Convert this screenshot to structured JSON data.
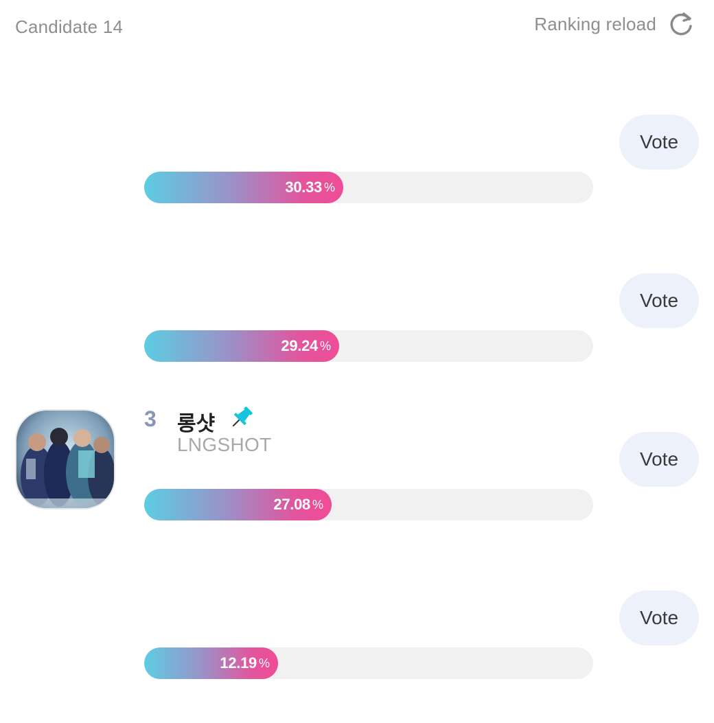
{
  "header": {
    "candidate_label": "Candidate 14",
    "reload_label": "Ranking reload"
  },
  "rows": [
    {
      "vote_label": "Vote",
      "percent": "30.33",
      "percent_sign": "%",
      "fill_fraction": 0.3033
    },
    {
      "vote_label": "Vote",
      "percent": "29.24",
      "percent_sign": "%",
      "fill_fraction": 0.2924
    },
    {
      "rank": "3",
      "name": "롱샷",
      "english_name": "LNGSHOT",
      "vote_label": "Vote",
      "percent": "27.08",
      "percent_sign": "%",
      "fill_fraction": 0.2708,
      "pinned": true
    },
    {
      "vote_label": "Vote",
      "percent": "12.19",
      "percent_sign": "%",
      "fill_fraction": 0.1219
    }
  ],
  "colors": {
    "gradient_start": "#5ccde3",
    "gradient_end": "#ef4c97",
    "pin": "#12c4dc",
    "vote_button_bg": "#ecf1fb"
  },
  "icons": {
    "reload": "refresh-icon",
    "pin": "pin-icon"
  }
}
